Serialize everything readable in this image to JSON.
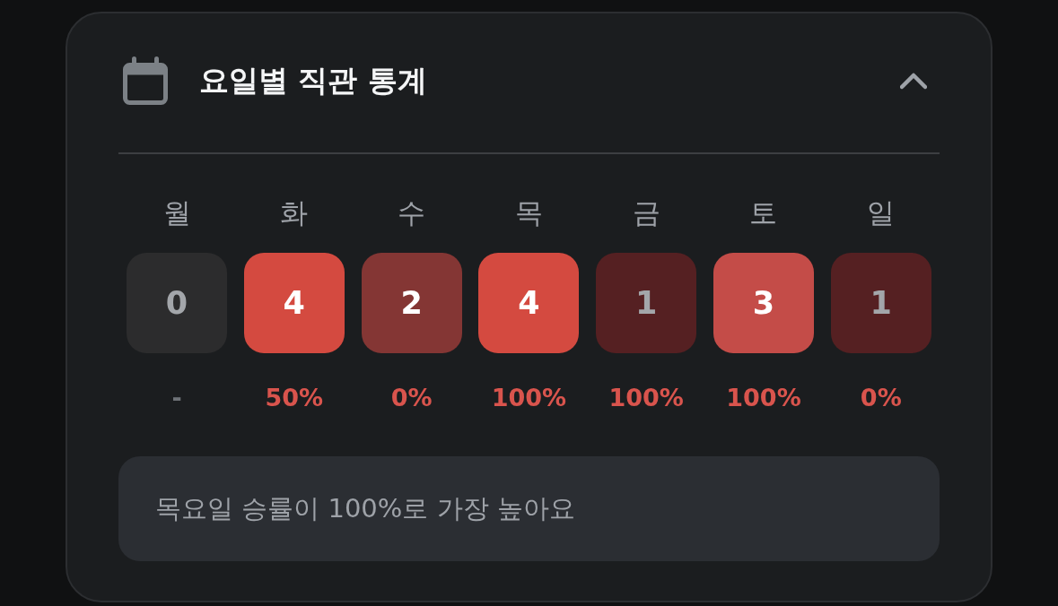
{
  "header": {
    "title": "요일별 직관 통계",
    "expanded": true
  },
  "days": [
    {
      "label": "월",
      "count": "0",
      "color": "#2c2c2d",
      "muted": true,
      "rate": {
        "text": "-",
        "dimmed": true
      }
    },
    {
      "label": "화",
      "count": "4",
      "color": "#d44a40",
      "muted": false,
      "rate": {
        "text": "50%",
        "dimmed": false
      }
    },
    {
      "label": "수",
      "count": "2",
      "color": "#843634",
      "muted": false,
      "rate": {
        "text": "0%",
        "dimmed": false
      }
    },
    {
      "label": "목",
      "count": "4",
      "color": "#d44a40",
      "muted": false,
      "rate": {
        "text": "100%",
        "dimmed": false
      }
    },
    {
      "label": "금",
      "count": "1",
      "color": "#552022",
      "muted": true,
      "rate": {
        "text": "100%",
        "dimmed": false
      }
    },
    {
      "label": "토",
      "count": "3",
      "color": "#c44c48",
      "muted": false,
      "rate": {
        "text": "100%",
        "dimmed": false
      }
    },
    {
      "label": "일",
      "count": "1",
      "color": "#552022",
      "muted": true,
      "rate": {
        "text": "0%",
        "dimmed": false
      }
    }
  ],
  "summary": "목요일 승률이 100%로 가장 높아요"
}
